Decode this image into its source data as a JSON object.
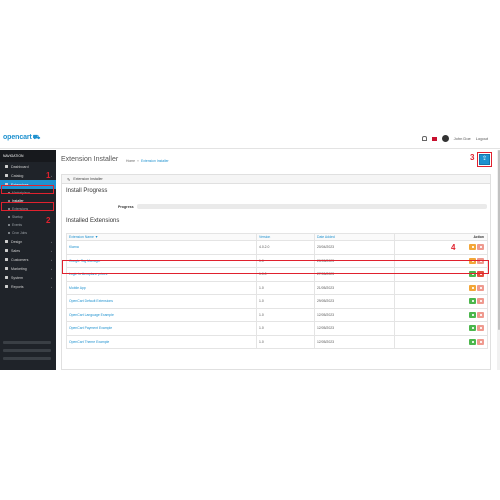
{
  "header": {
    "logo": "opencart",
    "user": "John Doe",
    "logout": "Logout"
  },
  "sidebar": {
    "title": "NAVIGATION",
    "items": [
      {
        "label": "Dashboard",
        "icon": "dashboard-icon"
      },
      {
        "label": "Catalog",
        "icon": "tag-icon"
      },
      {
        "label": "Extensions",
        "icon": "puzzle-icon",
        "active": true
      },
      {
        "label": "Design",
        "icon": "desktop-icon"
      },
      {
        "label": "Sales",
        "icon": "cart-icon"
      },
      {
        "label": "Customers",
        "icon": "user-icon"
      },
      {
        "label": "Marketing",
        "icon": "share-icon"
      },
      {
        "label": "System",
        "icon": "gear-icon"
      },
      {
        "label": "Reports",
        "icon": "chart-icon"
      }
    ],
    "sub_items": [
      {
        "label": "Marketplace"
      },
      {
        "label": "Installer",
        "current": true
      },
      {
        "label": "Extensions"
      },
      {
        "label": "Startup"
      },
      {
        "label": "Events"
      },
      {
        "label": "Cron Jobs"
      }
    ]
  },
  "annotations": {
    "one": "1",
    "two": "2",
    "three": "3",
    "four": "4"
  },
  "main": {
    "title": "Extension Installer",
    "breadcrumb": {
      "home": "Home",
      "current": "Extension Installer"
    },
    "panel_title": "Extension Installer",
    "install_progress": "Install Progress",
    "progress_label": "Progress",
    "installed_extensions": "Installed Extensions",
    "table": {
      "headers": {
        "name": "Extension Name ▼",
        "version": "Version",
        "date": "Date Added",
        "action": "Action"
      },
      "rows": [
        {
          "name": "Klarna",
          "version": "4.0.2.0",
          "date": "20/04/2023",
          "buttons": [
            "orange",
            "pink"
          ]
        },
        {
          "name": "Google Tag Manager",
          "version": "1.0",
          "date": "20/05/2023",
          "buttons": [
            "orange",
            "pink"
          ]
        },
        {
          "name": "Login to Aeroplane prices",
          "version": "1.0.0",
          "date": "27/05/2023",
          "buttons": [
            "green",
            "red"
          ]
        },
        {
          "name": "Mobile App",
          "version": "1.0",
          "date": "21/05/2023",
          "buttons": [
            "orange",
            "pink"
          ]
        },
        {
          "name": "OpenCart Default Extensions",
          "version": "1.0",
          "date": "29/05/2023",
          "buttons": [
            "green",
            "pink"
          ]
        },
        {
          "name": "OpenCart Language Example",
          "version": "1.0",
          "date": "12/05/2023",
          "buttons": [
            "green",
            "pink"
          ]
        },
        {
          "name": "OpenCart Payment Example",
          "version": "1.0",
          "date": "12/05/2023",
          "buttons": [
            "green",
            "pink"
          ]
        },
        {
          "name": "OpenCart Theme Example",
          "version": "1.0",
          "date": "12/05/2023",
          "buttons": [
            "green",
            "pink"
          ]
        }
      ]
    }
  }
}
